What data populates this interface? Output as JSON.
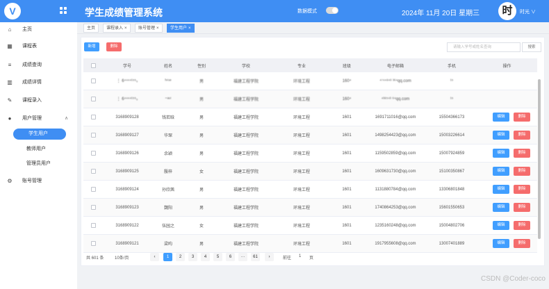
{
  "header": {
    "logo": "V",
    "app_title": "学生成绩管理系统",
    "mode_label": "数据模式",
    "date_text": "2024年 11月 20日   星期三",
    "avatar_char": "时",
    "username": "时光 ∨"
  },
  "sidebar": {
    "items": [
      {
        "label": "主页",
        "icon": "home-icon",
        "glyph": "⌂"
      },
      {
        "label": "课程表",
        "icon": "table-icon",
        "glyph": "▦"
      },
      {
        "label": "成绩查询",
        "icon": "list-icon",
        "glyph": "≡"
      },
      {
        "label": "成绩详情",
        "icon": "bar-chart-icon",
        "glyph": "▥"
      },
      {
        "label": "课程录入",
        "icon": "pen-icon",
        "glyph": "✎"
      },
      {
        "label": "用户管理",
        "icon": "user-icon",
        "glyph": "●"
      },
      {
        "label": "账号管理",
        "icon": "gear-icon",
        "glyph": "⚙"
      }
    ],
    "sub_items": [
      {
        "label": "学生用户"
      },
      {
        "label": "教师用户"
      },
      {
        "label": "管理员用户"
      }
    ],
    "expand_glyph": "∧"
  },
  "tabs": [
    {
      "label": "主页"
    },
    {
      "label": "课程录入",
      "close": "×"
    },
    {
      "label": "账号管理",
      "close": "×"
    },
    {
      "label": "学生用户",
      "close": "×"
    }
  ],
  "toolbar": {
    "add_label": "新增",
    "delete_label": "删除",
    "search_placeholder": "请输入学号或姓名查询",
    "search_label": "搜索"
  },
  "table": {
    "columns": [
      "学号",
      "姓名",
      "性别",
      "学校",
      "专业",
      "班级",
      "电子邮箱",
      "手机",
      "操作"
    ],
    "rows": [
      {
        "id": "⋮ 6⁴⁴⁴⁴¹⁵⁵₀",
        "name": "ʰᶦ⁽ᵘᵉ",
        "gender": "男",
        "school": "福建工程学院",
        "major": "环境工程",
        "class": "160⁴",
        "email": "⁴⁷⁴⁴⁸⁴³ ³⁶⁴qq.com",
        "phone": "¹⁵",
        "blurred": true
      },
      {
        "id": "⋮ 6⁴⁴⁴⁴¹⁵⁵₀",
        "name": "⁼ᵃᵘ⁽",
        "gender": "男",
        "school": "福建工程学院",
        "major": "环境工程",
        "class": "160⁴",
        "email": "⁴³⁸⁵⁴³ ⁶⁴qq.com",
        "phone": "¹⁵",
        "blurred": true
      },
      {
        "id": "3168909128",
        "name": "钱若晗",
        "gender": "男",
        "school": "福建工程学院",
        "major": "环境工程",
        "class": "1601",
        "email": "1691711016@qq.com",
        "phone": "15504366173",
        "blurred": false
      },
      {
        "id": "3168909127",
        "name": "华琛",
        "gender": "男",
        "school": "福建工程学院",
        "major": "环境工程",
        "class": "1601",
        "email": "1498254423@qq.com",
        "phone": "15003226614",
        "blurred": false
      },
      {
        "id": "3168909126",
        "name": "余颖",
        "gender": "男",
        "school": "福建工程学院",
        "major": "环境工程",
        "class": "1601",
        "email": "1159502859@qq.com",
        "phone": "15007924859",
        "blurred": false
      },
      {
        "id": "3168909125",
        "name": "殷梓",
        "gender": "女",
        "school": "福建工程学院",
        "major": "环境工程",
        "class": "1601",
        "email": "1609631730@qq.com",
        "phone": "15100350867",
        "blurred": false
      },
      {
        "id": "3168909124",
        "name": "孙欣茜",
        "gender": "男",
        "school": "福建工程学院",
        "major": "环境工程",
        "class": "1601",
        "email": "1131880784@qq.com",
        "phone": "13306801848",
        "blurred": false
      },
      {
        "id": "3168909123",
        "name": "魏阳",
        "gender": "男",
        "school": "福建工程学院",
        "major": "环境工程",
        "class": "1601",
        "email": "1740864253@qq.com",
        "phone": "15601550653",
        "blurred": false
      },
      {
        "id": "3168909122",
        "name": "伍园之",
        "gender": "女",
        "school": "福建工程学院",
        "major": "环境工程",
        "class": "1601",
        "email": "1235160248@qq.com",
        "phone": "15004802706",
        "blurred": false
      },
      {
        "id": "3168909121",
        "name": "梁昀",
        "gender": "男",
        "school": "福建工程学院",
        "major": "环境工程",
        "class": "1601",
        "email": "1917955608@qq.com",
        "phone": "13007401889",
        "blurred": false
      }
    ],
    "edit_label": "编辑",
    "delete_label": "删除"
  },
  "pagination": {
    "total_text": "共 601 条",
    "page_size": "10条/页",
    "prev": "‹",
    "next": "›",
    "pages": [
      "1",
      "2",
      "3",
      "4",
      "5",
      "6",
      "···",
      "61"
    ],
    "goto_label": "前往",
    "goto_value": "1",
    "goto_suffix": "页"
  },
  "watermark": "CSDN @Coder-coco"
}
